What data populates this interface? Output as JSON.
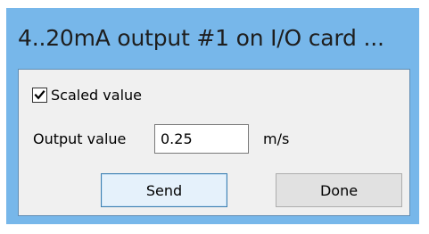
{
  "window": {
    "title": "4..20mA output #1 on I/O card ..."
  },
  "form": {
    "scaled_value_label": "Scaled value",
    "scaled_value_checked": true,
    "output_label": "Output value",
    "output_value": "0.25",
    "unit": "m/s"
  },
  "buttons": {
    "send_label": "Send",
    "done_label": "Done"
  },
  "icons": {
    "checkbox": "checkmark-icon"
  },
  "colors": {
    "title_bar": "#77b7ea",
    "client_background": "#f0f0f0",
    "default_button_border": "#3c7fb1"
  }
}
